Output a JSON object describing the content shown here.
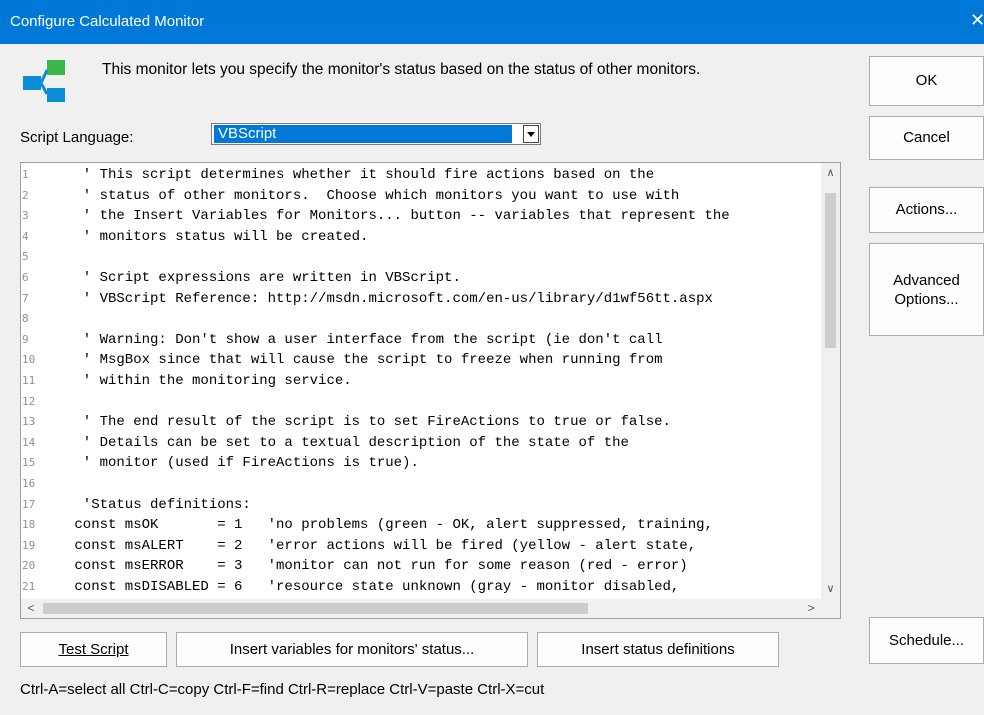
{
  "window": {
    "title": "Configure Calculated Monitor",
    "close_glyph": "✕"
  },
  "header": {
    "description": "This monitor lets you specify the monitor's status based on the status of other monitors."
  },
  "script_language": {
    "label": "Script Language:",
    "selected": "VBScript"
  },
  "editor": {
    "lines": [
      {
        "n": "1",
        "t": "  ' This script determines whether it should fire actions based on the"
      },
      {
        "n": "2",
        "t": "  ' status of other monitors.  Choose which monitors you want to use with"
      },
      {
        "n": "3",
        "t": "  ' the Insert Variables for Monitors... button -- variables that represent the"
      },
      {
        "n": "4",
        "t": "  ' monitors status will be created."
      },
      {
        "n": "5",
        "t": ""
      },
      {
        "n": "6",
        "t": "  ' Script expressions are written in VBScript."
      },
      {
        "n": "7",
        "t": "  ' VBScript Reference: http://msdn.microsoft.com/en-us/library/d1wf56tt.aspx"
      },
      {
        "n": "8",
        "t": ""
      },
      {
        "n": "9",
        "t": "  ' Warning: Don't show a user interface from the script (ie don't call"
      },
      {
        "n": "10",
        "t": "  ' MsgBox since that will cause the script to freeze when running from"
      },
      {
        "n": "11",
        "t": "  ' within the monitoring service."
      },
      {
        "n": "12",
        "t": ""
      },
      {
        "n": "13",
        "t": "  ' The end result of the script is to set FireActions to true or false."
      },
      {
        "n": "14",
        "t": "  ' Details can be set to a textual description of the state of the"
      },
      {
        "n": "15",
        "t": "  ' monitor (used if FireActions is true)."
      },
      {
        "n": "16",
        "t": ""
      },
      {
        "n": "17",
        "t": "  'Status definitions:"
      },
      {
        "n": "18",
        "t": " const msOK       = 1   'no problems (green - OK, alert suppressed, training,"
      },
      {
        "n": "19",
        "t": " const msALERT    = 2   'error actions will be fired (yellow - alert state,"
      },
      {
        "n": "20",
        "t": " const msERROR    = 3   'monitor can not run for some reason (red - error)"
      },
      {
        "n": "21",
        "t": " const msDISABLED = 6   'resource state unknown (gray - monitor disabled,"
      }
    ]
  },
  "buttons": {
    "ok": "OK",
    "cancel": "Cancel",
    "actions": "Actions...",
    "advanced_line1": "Advanced",
    "advanced_line2": "Options...",
    "schedule": "Schedule...",
    "test_script": "Test Script",
    "insert_vars": "Insert variables for monitors' status...",
    "insert_defs": "Insert status definitions"
  },
  "hint": "Ctrl-A=select all  Ctrl-C=copy  Ctrl-F=find  Ctrl-R=replace  Ctrl-V=paste  Ctrl-X=cut",
  "colors": {
    "title_bar": "#0078d7",
    "logo_green": "#3cb648",
    "logo_blue": "#0a8fd6"
  }
}
